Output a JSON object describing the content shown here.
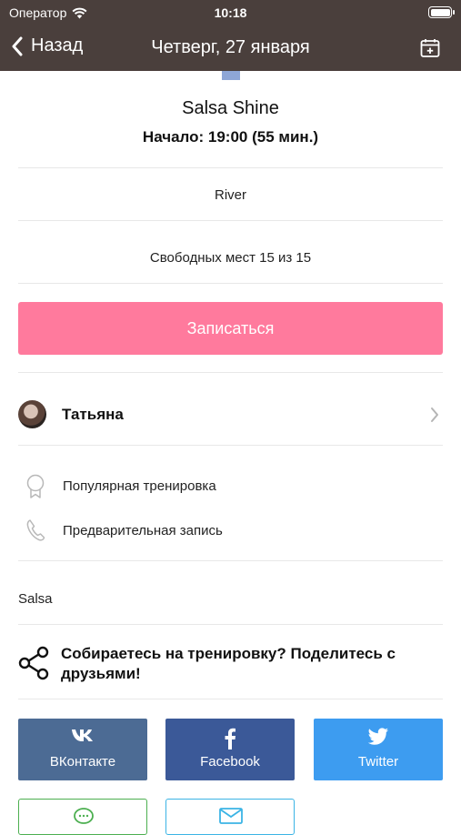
{
  "status_bar": {
    "carrier": "Оператор",
    "time": "10:18"
  },
  "nav": {
    "back_label": "Назад",
    "title": "Четверг, 27 января"
  },
  "class": {
    "title": "Salsa Shine",
    "start": "Начало: 19:00 (55 мин.)",
    "room": "River",
    "spots": "Свободных мест 15 из 15"
  },
  "signup_label": "Записаться",
  "trainer": {
    "name": "Татьяна"
  },
  "features": [
    {
      "label": "Популярная тренировка",
      "icon": "award-icon"
    },
    {
      "label": "Предварительная запись",
      "icon": "phone-icon"
    }
  ],
  "tag": "Salsa",
  "share": {
    "text": "Собираетесь на тренировку? Поделитесь с друзьями!"
  },
  "social": [
    {
      "label": "ВКонтакте",
      "color": "#4c6b94",
      "icon": "vk-icon"
    },
    {
      "label": "Facebook",
      "color": "#3b5998",
      "icon": "facebook-icon"
    },
    {
      "label": "Twitter",
      "color": "#3d9cf0",
      "icon": "twitter-icon"
    }
  ],
  "bottom_buttons": [
    {
      "icon": "message-icon",
      "color": "#4caf50"
    },
    {
      "icon": "mail-icon",
      "color": "#3bb4e5"
    }
  ],
  "colors": {
    "nav_background": "#4a3f3c",
    "accent_pink": "#ff7a9d"
  }
}
